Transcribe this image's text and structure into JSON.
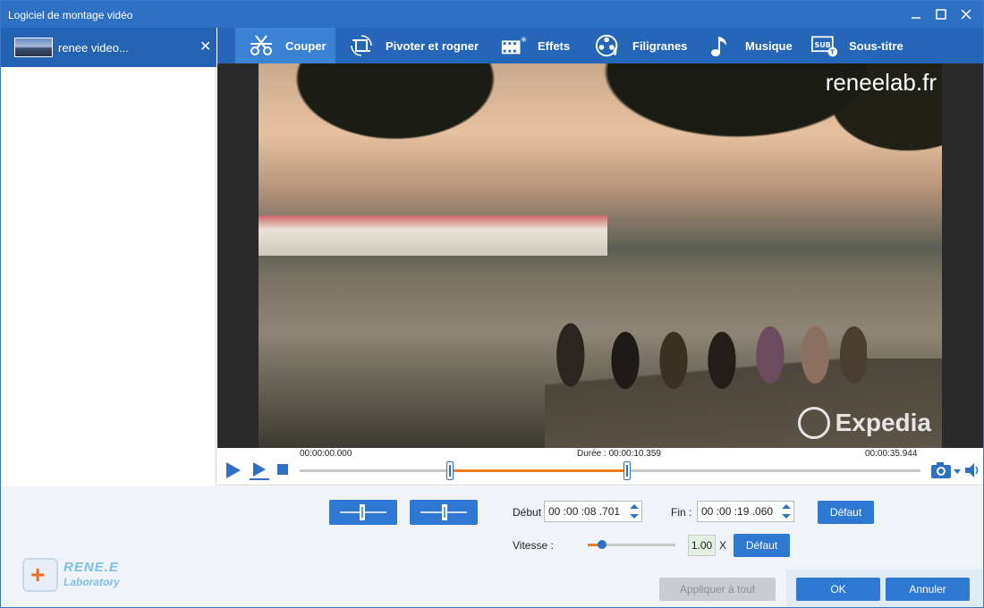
{
  "window": {
    "title": "Logiciel de montage vidéo",
    "min_icon": "minimize-icon",
    "max_icon": "maximize-icon",
    "close_icon": "close-icon"
  },
  "file_list": {
    "items": [
      {
        "name": "renee video...",
        "close": "✕"
      }
    ]
  },
  "tabs": [
    {
      "label": "Couper",
      "icon": "cut-icon",
      "active": true
    },
    {
      "label": "Pivoter et rogner",
      "icon": "rotate-crop-icon",
      "active": false
    },
    {
      "label": "Effets",
      "icon": "effects-icon",
      "active": false
    },
    {
      "label": "Filigranes",
      "icon": "watermark-icon",
      "active": false
    },
    {
      "label": "Musique",
      "icon": "music-icon",
      "active": false
    },
    {
      "label": "Sous-titre",
      "icon": "subtitle-icon",
      "active": false
    }
  ],
  "video": {
    "watermark_top": "reneelab.fr",
    "watermark_bottom": "Expedia"
  },
  "playback": {
    "start_time": "00:00:00.000",
    "duration_label": "Durée : 00:00:10.359",
    "end_time": "00:00:35.944",
    "selection_start_pct": 24.2,
    "selection_end_pct": 52.8
  },
  "trim": {
    "start_label": "Début",
    "start_value": "00 :00 :08 .701",
    "end_label": "Fin :",
    "end_value": "00 :00 :19 .060",
    "default_label": "Défaut"
  },
  "speed": {
    "label": "Vitesse :",
    "value": "1.00",
    "unit": "X",
    "default_label": "Défaut",
    "level_pct": 16
  },
  "footer": {
    "apply_all": "Appliquer à tout",
    "ok": "OK",
    "cancel": "Annuler"
  },
  "logo": {
    "line1": "RENE.E",
    "line2": "Laboratory"
  },
  "colors": {
    "titlebar": "#2e70c4",
    "tabbar": "#2566b9",
    "accent": "#2e78d2",
    "selection": "#f07c1e"
  }
}
